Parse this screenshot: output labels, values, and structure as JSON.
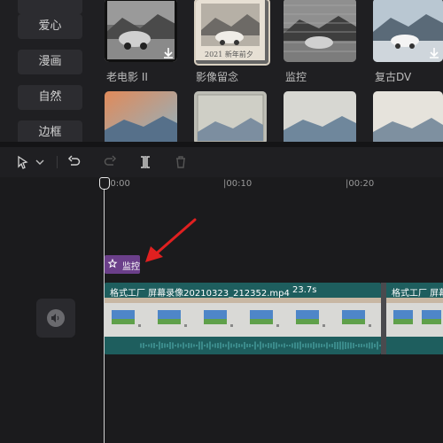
{
  "categories": [
    {
      "label": "爱心"
    },
    {
      "label": "漫画"
    },
    {
      "label": "自然"
    },
    {
      "label": "边框"
    }
  ],
  "effects_row1": [
    {
      "label": "老电影 II"
    },
    {
      "label": "影像留念",
      "overlay": "2021 新年前夕"
    },
    {
      "label": "监控"
    },
    {
      "label": "复古DV"
    }
  ],
  "toolbar": {
    "select_icon": "cursor-icon",
    "undo_icon": "undo-icon",
    "redo_icon": "redo-icon",
    "split_icon": "split-icon",
    "delete_icon": "trash-icon"
  },
  "ruler": {
    "ticks": [
      "00:00",
      "|00:10",
      "|00:20"
    ]
  },
  "effect_clip": {
    "label": "监控",
    "color": "#6b3f8a"
  },
  "video_clip": {
    "name": "格式工厂 屏幕录像20210323_212352.mp4",
    "duration": "23.7s",
    "next_name": "格式工厂 屏幕录",
    "color": "#1e5e5e"
  },
  "audio_track": {
    "icon": "speaker-icon"
  },
  "annotation": {
    "arrow_color": "#e02020"
  }
}
